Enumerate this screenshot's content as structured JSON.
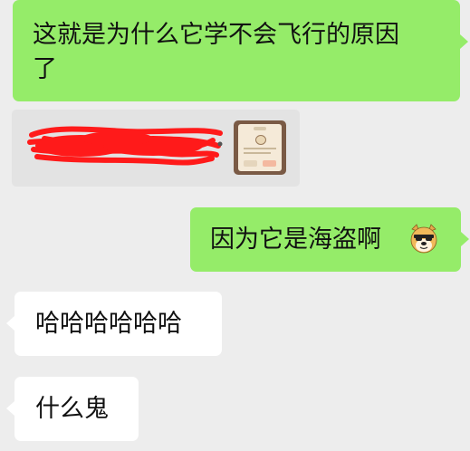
{
  "messages": [
    {
      "side": "right",
      "text_line1": "这就是为什么它学不会飞行的原因",
      "text_line2": "了"
    },
    {
      "side": "right",
      "text": "因为它是海盗啊",
      "emoji": "doge-sunglasses-icon"
    },
    {
      "side": "left",
      "text": "哈哈哈哈哈哈"
    },
    {
      "side": "left",
      "text": "什么鬼"
    }
  ],
  "quote": {
    "redacted": true,
    "thumbnail": "game-dialog-screenshot"
  },
  "colors": {
    "background": "#ededed",
    "outgoing_bubble": "#95ec69",
    "incoming_bubble": "#ffffff",
    "quote_bg": "#e3e3e3",
    "redaction": "#ff1a1a"
  }
}
